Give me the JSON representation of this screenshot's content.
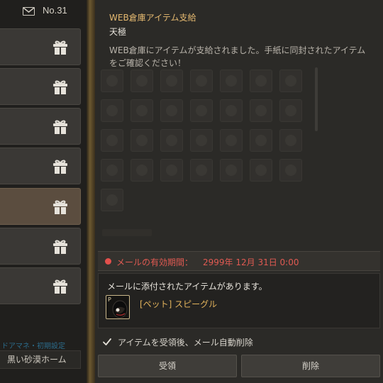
{
  "mail_list": {
    "count_label": "No.31",
    "items": [
      {
        "selected": false
      },
      {
        "selected": false
      },
      {
        "selected": false
      },
      {
        "selected": false
      },
      {
        "selected": true
      },
      {
        "selected": false
      },
      {
        "selected": false
      }
    ],
    "footer_text": "ドアマネ・初期設定",
    "home_button_label": "黒い砂漠ホーム"
  },
  "mail_detail": {
    "title": "WEB倉庫アイテム支給",
    "sender": "天極",
    "body": "WEB倉庫にアイテムが支給されました。手紙に同封されたアイテムをご確認ください！",
    "expiry_label": "メールの有効期間：",
    "expiry_value": "2999年 12月 31日 0:00",
    "attachment_heading": "メールに添付されたアイテムがあります。",
    "item_name": "[ペット] スピーグル",
    "item_grade_mark": "P",
    "auto_delete_label": "アイテムを受領後、メール自動削除",
    "auto_delete_checked": true,
    "receive_button": "受領",
    "delete_button": "削除"
  },
  "colors": {
    "accent_gold": "#e5b970",
    "expiry_red": "#e05a52",
    "item_name_gold": "#e2b35c",
    "selected_item_bg": "#5b4d3f"
  },
  "icons": {
    "mail_header": "envelope-icon",
    "mail_item": "gift-icon",
    "auto_delete": "checkmark-icon"
  }
}
